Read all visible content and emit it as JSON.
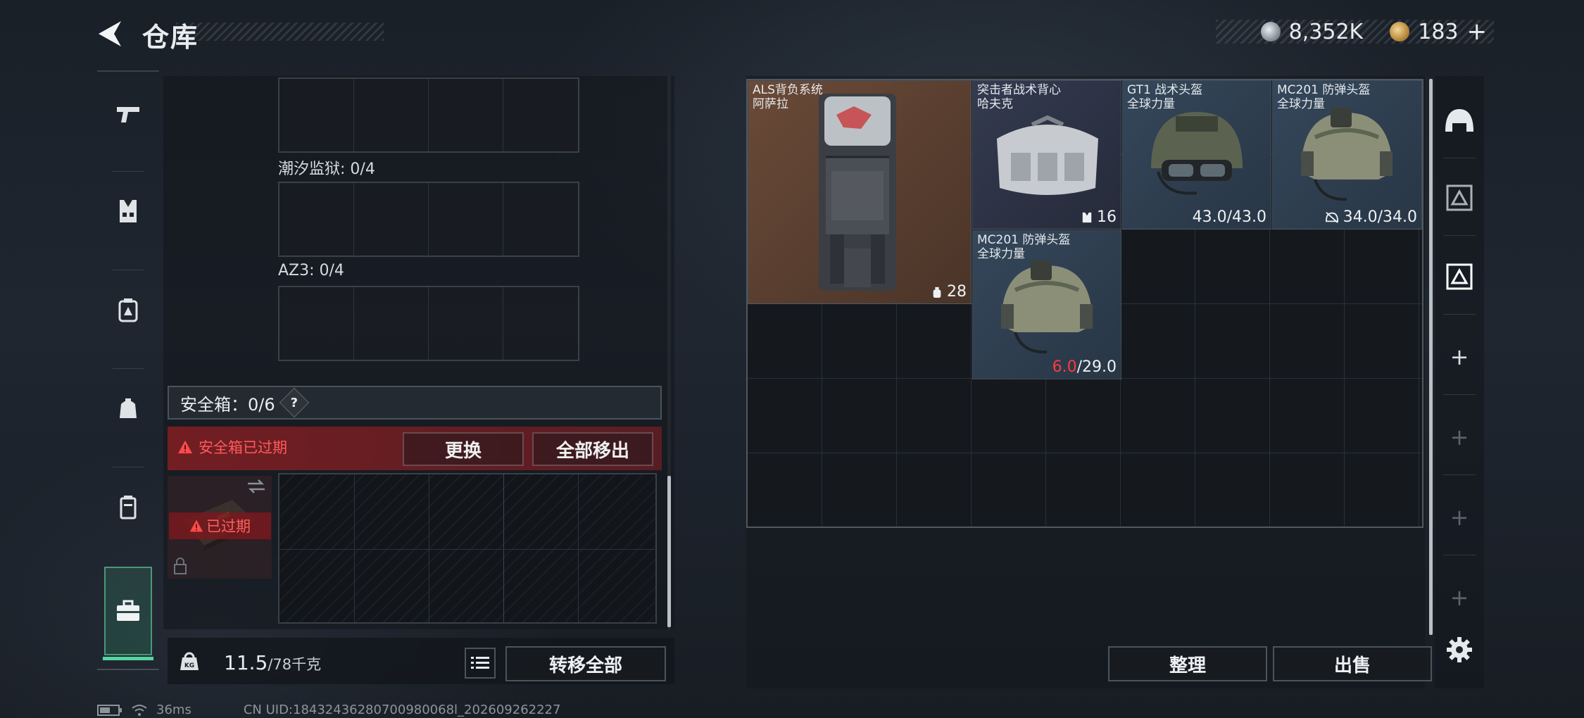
{
  "header": {
    "title": "仓库",
    "silver_amount": "8,352K",
    "gold_amount": "183",
    "gold_plus": "+"
  },
  "sidebar": {
    "items": [
      {
        "icon": "pistol-icon"
      },
      {
        "icon": "vest-icon"
      },
      {
        "icon": "backpack-icon"
      },
      {
        "icon": "pouch-icon"
      },
      {
        "icon": "canister-icon"
      },
      {
        "icon": "case-icon",
        "active": true
      }
    ]
  },
  "left_panel": {
    "containers": [
      {
        "label": ""
      },
      {
        "label": "潮汐监狱: 0/4"
      },
      {
        "label": "AZ3: 0/4"
      }
    ],
    "safe_box": {
      "label": "安全箱：0/6",
      "help": "?",
      "expired_notice": "安全箱已过期",
      "replace_label": "更换",
      "remove_all_label": "全部移出",
      "case_expired_label": "已过期"
    },
    "weight": {
      "current": "11.5",
      "max": "/78千克",
      "icon_label": "KG"
    },
    "transfer_all_label": "转移全部"
  },
  "stash": {
    "items": [
      {
        "name": "ALS背负系统",
        "sub": "阿萨拉",
        "stat": "28",
        "stat_icon": "backpack-capacity-icon",
        "color": "#5a3e30"
      },
      {
        "name": "突击者战术背心",
        "sub": "哈夫克",
        "stat": "16",
        "stat_icon": "vest-capacity-icon",
        "color": "#2f3548"
      },
      {
        "name": "GT1 战术头盔",
        "sub": "全球力量",
        "stat": "43.0/43.0",
        "color": "#2f3f52"
      },
      {
        "name": "MC201 防弹头盔",
        "sub": "全球力量",
        "stat": "34.0/34.0",
        "stat_icon": "broken-helmet-icon",
        "color": "#2f3f52"
      },
      {
        "name": "MC201 防弹头盔",
        "sub": "全球力量",
        "stat_current": "6.0",
        "stat_max": "/29.0",
        "color": "#2f3f52"
      }
    ],
    "sort_label": "整理",
    "sell_label": "出售"
  },
  "right_tabs": {
    "items": [
      "helmet-slot-icon",
      "armor-slot-icon",
      "armor-slot-active-icon",
      "plus-icon",
      "plus-icon",
      "plus-icon",
      "plus-icon"
    ],
    "settings_icon": "gear-icon"
  },
  "status_bar": {
    "ping": "36ms",
    "uid": "CN UID:18432436280700980068l_202609262227"
  },
  "colors": {
    "accent_green": "#53d6a0",
    "expired_red": "#ff3b3b",
    "backpack_bg": "#5a3e30",
    "vest_bg": "#2f3548",
    "helmet_bg": "#2f3f52"
  }
}
